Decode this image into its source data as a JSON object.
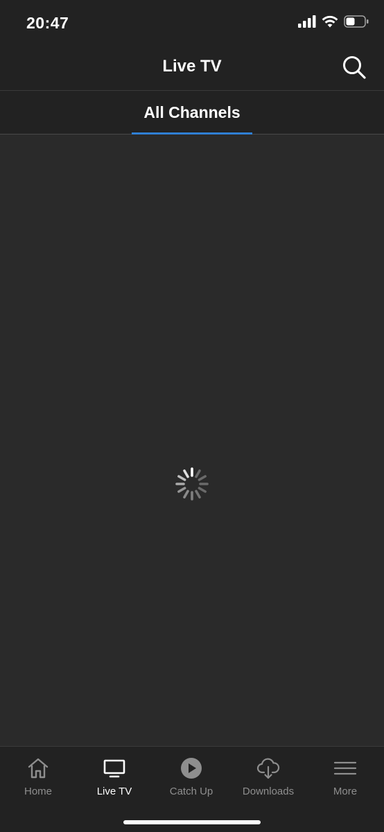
{
  "status_bar": {
    "time": "20:47",
    "signal_icon": "cellular-signal-icon",
    "wifi_icon": "wifi-icon",
    "battery_icon": "battery-icon"
  },
  "header": {
    "title": "Live TV",
    "search_icon": "search-icon"
  },
  "tabs": [
    {
      "label": "All Channels",
      "active": true
    }
  ],
  "content": {
    "loading_icon": "loading-spinner-icon"
  },
  "bottom_nav": {
    "items": [
      {
        "label": "Home",
        "icon": "home-icon",
        "active": false
      },
      {
        "label": "Live TV",
        "icon": "tv-icon",
        "active": true
      },
      {
        "label": "Catch Up",
        "icon": "play-circle-icon",
        "active": false
      },
      {
        "label": "Downloads",
        "icon": "cloud-download-icon",
        "active": false
      },
      {
        "label": "More",
        "icon": "menu-icon",
        "active": false
      }
    ]
  },
  "colors": {
    "background": "#2a2a2a",
    "bar_background": "#222222",
    "accent": "#2f7fd4",
    "inactive": "#8e8e8e",
    "active": "#ffffff"
  }
}
